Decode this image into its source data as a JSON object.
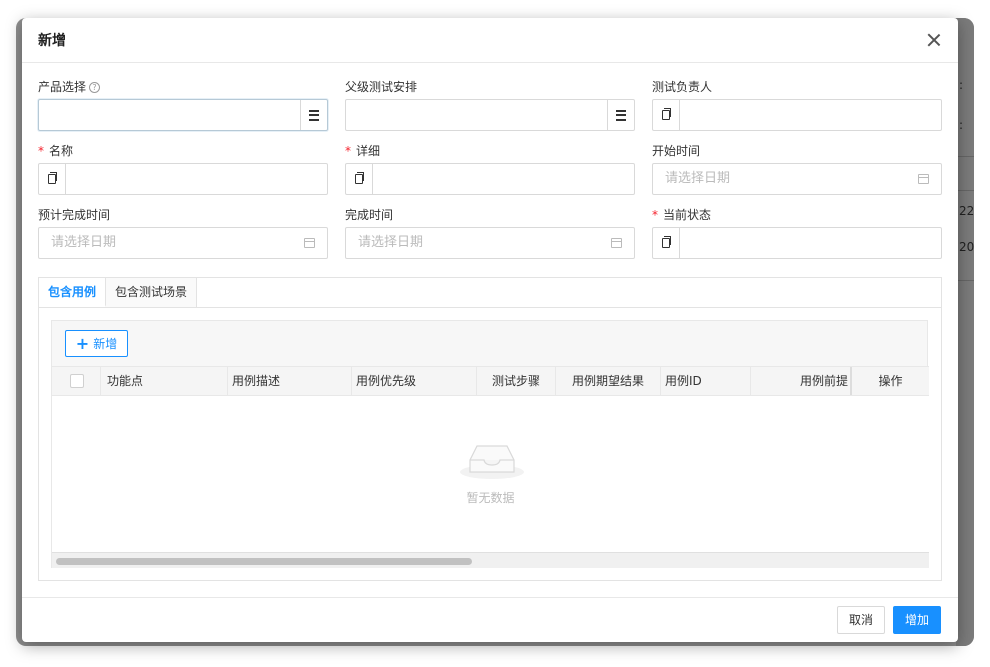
{
  "modal": {
    "title": "新增"
  },
  "background": {
    "cells": [
      ":",
      ":",
      "22",
      "20"
    ]
  },
  "form": {
    "product_select": {
      "label": "产品选择",
      "required": false,
      "help": "?"
    },
    "parent_test_plan": {
      "label": "父级测试安排",
      "required": false
    },
    "test_owner": {
      "label": "测试负责人",
      "required": false
    },
    "name": {
      "label": "名称",
      "required": true
    },
    "detail": {
      "label": "详细",
      "required": true
    },
    "start_time": {
      "label": "开始时间",
      "placeholder": "请选择日期"
    },
    "planned_finish_time": {
      "label": "预计完成时间",
      "placeholder": "请选择日期"
    },
    "finish_time": {
      "label": "完成时间",
      "placeholder": "请选择日期"
    },
    "current_status": {
      "label": "当前状态",
      "required": true
    },
    "required_mark": "*"
  },
  "tabs": [
    {
      "label": "包含用例",
      "active": true
    },
    {
      "label": "包含测试场景",
      "active": false
    }
  ],
  "case_table": {
    "add_label": "新增",
    "columns": [
      "功能点",
      "用例描述",
      "用例优先级",
      "测试步骤",
      "用例期望结果",
      "用例ID",
      "用例前提",
      "操作"
    ],
    "empty_text": "暂无数据"
  },
  "footer": {
    "cancel_label": "取消",
    "ok_label": "增加"
  },
  "colors": {
    "primary": "#1890ff",
    "required": "#f5222d"
  },
  "icons": [
    "close-icon",
    "help-icon",
    "list-icon",
    "copy-icon",
    "calendar-icon",
    "plus-icon",
    "empty-box-icon"
  ]
}
